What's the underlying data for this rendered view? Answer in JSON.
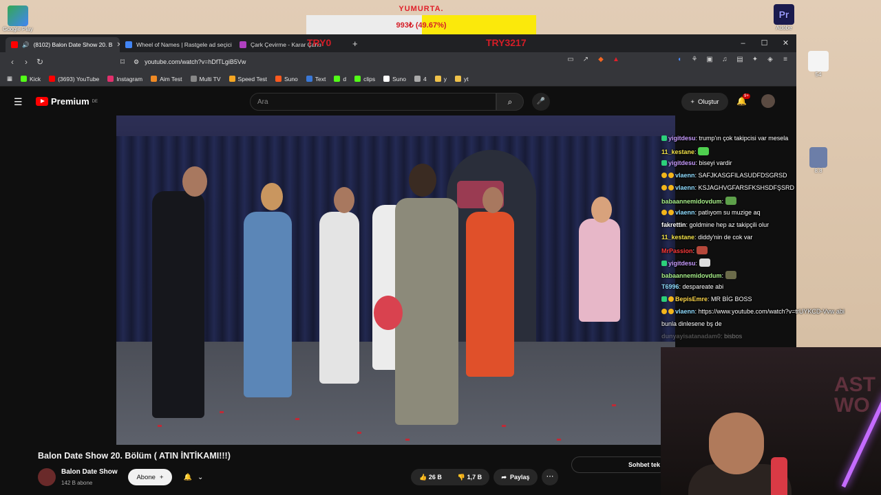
{
  "desktop": {
    "google_play_label": "Google Play",
    "adobe_label": "Adobe",
    "premiere_short": "Pr",
    "side_label_1": "54",
    "side_label_2": "8.8"
  },
  "donation_goal": {
    "title": "YUMURTA.",
    "progress_text": "993₺ (49.67%)",
    "progress_fraction": 0.4967
  },
  "overlay": {
    "try_left": "TRY0",
    "try_right": "TRY3217"
  },
  "tabs": [
    {
      "label": "(8102) Balon Date Show 20. B",
      "active": true,
      "color": "#ff0000"
    },
    {
      "label": "Wheel of Names | Rastgele ad seçici",
      "active": false,
      "color": "#4285f4"
    },
    {
      "label": "Çark Çevirme - Karar Çarkı",
      "active": false,
      "color": "#b040c0"
    }
  ],
  "address": {
    "url": "youtube.com/watch?v=hDfTLgiB5Vw"
  },
  "bookmarks": [
    {
      "label": "Kick",
      "color": "#53fc18"
    },
    {
      "label": "(3693) YouTube",
      "color": "#ff0000"
    },
    {
      "label": "Instagram",
      "color": "#e1306c"
    },
    {
      "label": "Aim Test",
      "color": "#f08a24"
    },
    {
      "label": "Multi TV",
      "color": "#888888"
    },
    {
      "label": "Speed Test",
      "color": "#f5a623"
    },
    {
      "label": "Suno",
      "color": "#ff5a1f"
    },
    {
      "label": "Text",
      "color": "#3a78d6"
    },
    {
      "label": "d",
      "color": "#53fc18"
    },
    {
      "label": "clips",
      "color": "#53fc18"
    },
    {
      "label": "Suno",
      "color": "#ffffff"
    },
    {
      "label": "4",
      "color": "#aaaaaa"
    },
    {
      "label": "y",
      "color": "#f0c24a"
    },
    {
      "label": "yt",
      "color": "#f0c24a"
    }
  ],
  "youtube": {
    "logo_text": "Premium",
    "logo_region": "DE",
    "search_placeholder": "Ara",
    "create_label": "Oluştur",
    "notif_badge": "9+",
    "video_title": "Balon Date Show 20. Bölüm ( ATIN İNTİKAMI!!!)",
    "channel_name": "Balon Date Show",
    "channel_subs": "142 B abone",
    "subscribe_label": "Abone",
    "like_count": "26 B",
    "dislike_count": "1,7 B",
    "share_label": "Paylaş",
    "chat_toggle_label": "Sohbet tek"
  },
  "chat": [
    {
      "user": "yigitdesu",
      "user_color": "#c89cff",
      "text": "trump'ın çok takipcisi var mesela",
      "badges": [
        "g"
      ]
    },
    {
      "user": "11_kestane",
      "user_color": "#f3e24a",
      "text": "",
      "badges": [],
      "emote": "#4fd04f"
    },
    {
      "user": "yigitdesu",
      "user_color": "#c89cff",
      "text": "biseyi vardir",
      "badges": [
        "g"
      ]
    },
    {
      "user": "vlaenn",
      "user_color": "#8fdcff",
      "text": "SAFJKASGFILASUDFDSGRSD",
      "badges": [
        "y",
        "y"
      ]
    },
    {
      "user": "vlaenn",
      "user_color": "#8fdcff",
      "text": "KSJAGHVGFARSFKSHSDFŞSRD",
      "badges": [
        "y",
        "y"
      ]
    },
    {
      "user": "babaannemidovdum",
      "user_color": "#a8f08a",
      "text": "",
      "badges": [],
      "emote": "#5da04a"
    },
    {
      "user": "vlaenn",
      "user_color": "#8fdcff",
      "text": "patlıyom su muzige aq",
      "badges": [
        "y",
        "y"
      ]
    },
    {
      "user": "fakrettin",
      "user_color": "#ffffff",
      "text": "goldmine hep az takipçili olur",
      "badges": []
    },
    {
      "user": "11_kestane",
      "user_color": "#f3e24a",
      "text": "diddy'nin de cok var",
      "badges": []
    },
    {
      "user": "MrPassion",
      "user_color": "#ff3b3b",
      "text": "",
      "badges": [],
      "emote": "#b5473a"
    },
    {
      "user": "yigitdesu",
      "user_color": "#c89cff",
      "text": "",
      "badges": [
        "g"
      ],
      "emote": "#dddddd"
    },
    {
      "user": "babaannemidovdum",
      "user_color": "#a8f08a",
      "text": "",
      "badges": [],
      "emote": "#6b6b4a"
    },
    {
      "user": "T6996",
      "user_color": "#8fdcff",
      "text": "despareate abi",
      "badges": []
    },
    {
      "user": "BepisEmre",
      "user_color": "#ffd84a",
      "text": "MR BİG BOSS",
      "badges": [
        "g",
        "y"
      ]
    },
    {
      "user": "vlaenn",
      "user_color": "#8fdcff",
      "text": "https://www.youtube.com/watch?v=trUYKCD-Vvw abi",
      "badges": [
        "y",
        "y"
      ]
    },
    {
      "user": "",
      "user_color": "#ffffff",
      "text": "bunla dinlesene bş de",
      "badges": []
    },
    {
      "user": "dunyayisatanadam0",
      "user_color": "#9a9a9a",
      "text": "bisbos",
      "badges": []
    }
  ],
  "cam": {
    "wall_letters": "AST\nWO"
  }
}
